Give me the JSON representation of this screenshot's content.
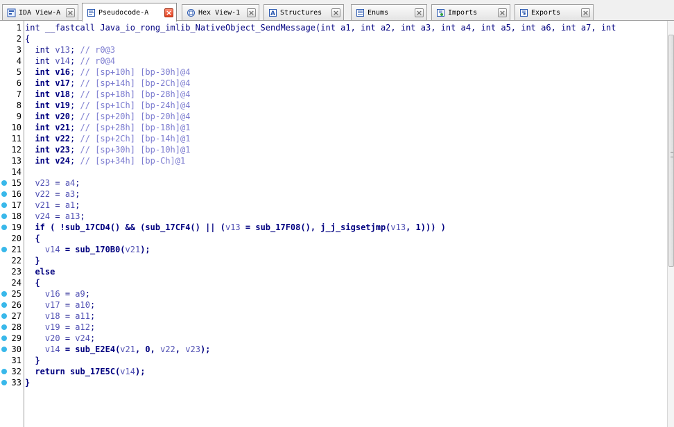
{
  "tabs": [
    {
      "label": "IDA View-A",
      "icon": "ida-view-icon",
      "active": false
    },
    {
      "label": "Pseudocode-A",
      "icon": "pseudocode-icon",
      "active": true
    },
    {
      "label": "Hex View-1",
      "icon": "hex-view-icon",
      "active": false
    },
    {
      "label": "Structures",
      "icon": "structures-icon",
      "active": false
    },
    {
      "label": "Enums",
      "icon": "enums-icon",
      "active": false
    },
    {
      "label": "Imports",
      "icon": "imports-icon",
      "active": false
    },
    {
      "label": "Exports",
      "icon": "exports-icon",
      "active": false
    }
  ],
  "colors": {
    "keyword": "#000080",
    "variable": "#5050b4",
    "comment": "#7c7cd0",
    "breakpoint_dot": "#39b8ea",
    "close_active": "#e0401f"
  },
  "code": [
    {
      "n": "1",
      "dot": false,
      "tokens": [
        [
          "kw-plain",
          "int __fastcall Java_io_rong_imlib_NativeObject_SendMessage(int a1, int a2, int a3, int a4, int a5, int a6, int a7, int"
        ]
      ]
    },
    {
      "n": "2",
      "dot": false,
      "tokens": [
        [
          "sym",
          "{"
        ]
      ]
    },
    {
      "n": "3",
      "dot": false,
      "tokens": [
        [
          "plain",
          "  int "
        ],
        [
          "var",
          "v13"
        ],
        [
          "plain",
          "; "
        ],
        [
          "cmt",
          "// r0@3"
        ]
      ]
    },
    {
      "n": "4",
      "dot": false,
      "tokens": [
        [
          "plain",
          "  int "
        ],
        [
          "var",
          "v14"
        ],
        [
          "plain",
          "; "
        ],
        [
          "cmt",
          "// r0@4"
        ]
      ]
    },
    {
      "n": "5",
      "dot": false,
      "tokens": [
        [
          "kw",
          "  int "
        ],
        [
          "kw",
          "v16"
        ],
        [
          "plain",
          "; "
        ],
        [
          "cmt",
          "// [sp+10h] [bp-30h]@4"
        ]
      ]
    },
    {
      "n": "6",
      "dot": false,
      "tokens": [
        [
          "kw",
          "  int "
        ],
        [
          "kw",
          "v17"
        ],
        [
          "plain",
          "; "
        ],
        [
          "cmt",
          "// [sp+14h] [bp-2Ch]@4"
        ]
      ]
    },
    {
      "n": "7",
      "dot": false,
      "tokens": [
        [
          "kw",
          "  int "
        ],
        [
          "kw",
          "v18"
        ],
        [
          "plain",
          "; "
        ],
        [
          "cmt",
          "// [sp+18h] [bp-28h]@4"
        ]
      ]
    },
    {
      "n": "8",
      "dot": false,
      "tokens": [
        [
          "kw",
          "  int "
        ],
        [
          "kw",
          "v19"
        ],
        [
          "plain",
          "; "
        ],
        [
          "cmt",
          "// [sp+1Ch] [bp-24h]@4"
        ]
      ]
    },
    {
      "n": "9",
      "dot": false,
      "tokens": [
        [
          "kw",
          "  int "
        ],
        [
          "kw",
          "v20"
        ],
        [
          "plain",
          "; "
        ],
        [
          "cmt",
          "// [sp+20h] [bp-20h]@4"
        ]
      ]
    },
    {
      "n": "10",
      "dot": false,
      "tokens": [
        [
          "kw",
          "  int "
        ],
        [
          "kw",
          "v21"
        ],
        [
          "plain",
          "; "
        ],
        [
          "cmt",
          "// [sp+28h] [bp-18h]@1"
        ]
      ]
    },
    {
      "n": "11",
      "dot": false,
      "tokens": [
        [
          "kw",
          "  int "
        ],
        [
          "kw",
          "v22"
        ],
        [
          "plain",
          "; "
        ],
        [
          "cmt",
          "// [sp+2Ch] [bp-14h]@1"
        ]
      ]
    },
    {
      "n": "12",
      "dot": false,
      "tokens": [
        [
          "kw",
          "  int "
        ],
        [
          "kw",
          "v23"
        ],
        [
          "plain",
          "; "
        ],
        [
          "cmt",
          "// [sp+30h] [bp-10h]@1"
        ]
      ]
    },
    {
      "n": "13",
      "dot": false,
      "tokens": [
        [
          "kw",
          "  int "
        ],
        [
          "kw",
          "v24"
        ],
        [
          "plain",
          "; "
        ],
        [
          "cmt",
          "// [sp+34h] [bp-Ch]@1"
        ]
      ]
    },
    {
      "n": "14",
      "dot": false,
      "tokens": []
    },
    {
      "n": "15",
      "dot": true,
      "tokens": [
        [
          "plain",
          "  "
        ],
        [
          "var",
          "v23"
        ],
        [
          "plain",
          " = "
        ],
        [
          "var",
          "a4"
        ],
        [
          "plain",
          ";"
        ]
      ]
    },
    {
      "n": "16",
      "dot": true,
      "tokens": [
        [
          "plain",
          "  "
        ],
        [
          "var",
          "v22"
        ],
        [
          "plain",
          " = "
        ],
        [
          "var",
          "a3"
        ],
        [
          "plain",
          ";"
        ]
      ]
    },
    {
      "n": "17",
      "dot": true,
      "tokens": [
        [
          "plain",
          "  "
        ],
        [
          "var",
          "v21"
        ],
        [
          "plain",
          " = "
        ],
        [
          "var",
          "a1"
        ],
        [
          "plain",
          ";"
        ]
      ]
    },
    {
      "n": "18",
      "dot": true,
      "tokens": [
        [
          "plain",
          "  "
        ],
        [
          "var",
          "v24"
        ],
        [
          "plain",
          " = "
        ],
        [
          "var",
          "a13"
        ],
        [
          "plain",
          ";"
        ]
      ]
    },
    {
      "n": "19",
      "dot": true,
      "tokens": [
        [
          "kw",
          "  if ( !sub_17CD4() && (sub_17CF4() || ("
        ],
        [
          "var",
          "v13"
        ],
        [
          "kw",
          " = sub_17F08(), j_j_sigsetjmp("
        ],
        [
          "var",
          "v13"
        ],
        [
          "kw",
          ", 1))) )"
        ]
      ]
    },
    {
      "n": "20",
      "dot": false,
      "tokens": [
        [
          "kw",
          "  {"
        ]
      ]
    },
    {
      "n": "21",
      "dot": true,
      "tokens": [
        [
          "plain",
          "    "
        ],
        [
          "var",
          "v14"
        ],
        [
          "kw",
          " = sub_170B0("
        ],
        [
          "var",
          "v21"
        ],
        [
          "kw",
          ");"
        ]
      ]
    },
    {
      "n": "22",
      "dot": false,
      "tokens": [
        [
          "kw",
          "  }"
        ]
      ]
    },
    {
      "n": "23",
      "dot": false,
      "tokens": [
        [
          "kw",
          "  else"
        ]
      ]
    },
    {
      "n": "24",
      "dot": false,
      "tokens": [
        [
          "kw",
          "  {"
        ]
      ]
    },
    {
      "n": "25",
      "dot": true,
      "tokens": [
        [
          "plain",
          "    "
        ],
        [
          "var",
          "v16"
        ],
        [
          "plain",
          " = "
        ],
        [
          "var",
          "a9"
        ],
        [
          "plain",
          ";"
        ]
      ]
    },
    {
      "n": "26",
      "dot": true,
      "tokens": [
        [
          "plain",
          "    "
        ],
        [
          "var",
          "v17"
        ],
        [
          "plain",
          " = "
        ],
        [
          "var",
          "a10"
        ],
        [
          "plain",
          ";"
        ]
      ]
    },
    {
      "n": "27",
      "dot": true,
      "tokens": [
        [
          "plain",
          "    "
        ],
        [
          "var",
          "v18"
        ],
        [
          "plain",
          " = "
        ],
        [
          "var",
          "a11"
        ],
        [
          "plain",
          ";"
        ]
      ]
    },
    {
      "n": "28",
      "dot": true,
      "tokens": [
        [
          "plain",
          "    "
        ],
        [
          "var",
          "v19"
        ],
        [
          "plain",
          " = "
        ],
        [
          "var",
          "a12"
        ],
        [
          "plain",
          ";"
        ]
      ]
    },
    {
      "n": "29",
      "dot": true,
      "tokens": [
        [
          "plain",
          "    "
        ],
        [
          "var",
          "v20"
        ],
        [
          "plain",
          " = "
        ],
        [
          "var",
          "v24"
        ],
        [
          "plain",
          ";"
        ]
      ]
    },
    {
      "n": "30",
      "dot": true,
      "tokens": [
        [
          "plain",
          "    "
        ],
        [
          "var",
          "v14"
        ],
        [
          "kw",
          " = sub_E2E4("
        ],
        [
          "var",
          "v21"
        ],
        [
          "kw",
          ", 0, "
        ],
        [
          "var",
          "v22"
        ],
        [
          "kw",
          ", "
        ],
        [
          "var",
          "v23"
        ],
        [
          "kw",
          ");"
        ]
      ]
    },
    {
      "n": "31",
      "dot": false,
      "tokens": [
        [
          "kw",
          "  }"
        ]
      ]
    },
    {
      "n": "32",
      "dot": true,
      "tokens": [
        [
          "kw",
          "  return sub_17E5C("
        ],
        [
          "var",
          "v14"
        ],
        [
          "kw",
          ");"
        ]
      ]
    },
    {
      "n": "33",
      "dot": true,
      "tokens": [
        [
          "kw",
          "}"
        ]
      ]
    }
  ]
}
